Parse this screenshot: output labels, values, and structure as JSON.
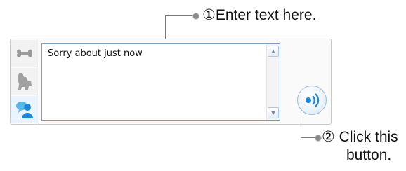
{
  "callouts": {
    "step1": "①Enter text here.",
    "step2_line1": "② Click this",
    "step2_line2": "button."
  },
  "textbox": {
    "value": "Sorry about just now"
  },
  "side_tools": [
    {
      "icon": "bone-icon"
    },
    {
      "icon": "dog-icon"
    },
    {
      "icon": "chat-people-icon"
    }
  ],
  "send_button": {
    "icon": "speaker-send-icon"
  },
  "colors": {
    "accent": "#1e88d6",
    "border": "#c9c9c9"
  }
}
